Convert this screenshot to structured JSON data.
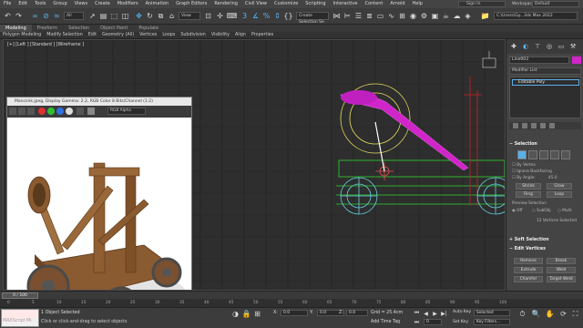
{
  "menu": [
    "File",
    "Edit",
    "Tools",
    "Group",
    "Views",
    "Create",
    "Modifiers",
    "Animation",
    "Graph Editors",
    "Rendering",
    "Civil View",
    "Customize",
    "Scripting",
    "Interactive",
    "Content",
    "Arnold",
    "Help"
  ],
  "signin": "Sign In",
  "workspaces_label": "Workspaces:",
  "workspace_value": "Default",
  "toolbar": {
    "view_dropdown": "View",
    "create_selection_set": "Create Selection Se",
    "path_value": "C:\\Users\\Gy...3ds Max 2022"
  },
  "ribbon_tabs": [
    "Modeling",
    "Freeform",
    "Selection",
    "Object Paint",
    "Populate"
  ],
  "ribbon_row2": [
    "Polygon Modeling",
    "Modify Selection",
    "Edit",
    "Geometry (All)",
    "Vertices",
    "Loops",
    "Subdivision",
    "Visibility",
    "Align",
    "Properties"
  ],
  "viewport_label": "[+] [Left ] [Standard ] [Wireframe ]",
  "frame_window": {
    "title": "Mancinik.jpeg, Display Gamma: 2.2, RGB Color 8 Bits/Channel (1:2)",
    "channel_dropdown": "RGB Alpha"
  },
  "command_panel": {
    "object_name": "Line003",
    "modifier_list": "Modifier List",
    "stack_item": "Editable Poly",
    "selection_header": "Selection",
    "by_vertex": "By Vertex",
    "ignore_backfacing": "Ignore Backfacing",
    "by_angle": "By Angle:",
    "by_angle_value": "45.0",
    "shrink": "Shrink",
    "grow": "Grow",
    "ring": "Ring",
    "loop": "Loop",
    "preview_selection": "Preview Selection",
    "preview_off": "Off",
    "preview_subobj": "SubObj",
    "preview_multi": "Multi",
    "vertices_selected": "12 Vertices Selected",
    "soft_selection": "Soft Selection",
    "edit_vertices": "Edit Vertices",
    "remove": "Remove",
    "break": "Break",
    "extrude": "Extrude",
    "weld": "Weld",
    "chamfer": "Chamfer",
    "target_weld": "Target Weld"
  },
  "timeline": {
    "slider": "0 / 100",
    "ticks": [
      "0",
      "5",
      "10",
      "15",
      "20",
      "25",
      "30",
      "35",
      "40",
      "45",
      "50",
      "55",
      "60",
      "65",
      "70",
      "75",
      "80",
      "85",
      "90",
      "95",
      "100"
    ]
  },
  "status": {
    "maxscript": "MAXScript Mi",
    "selected": "1 Object Selected",
    "prompt": "Click or click-and-drag to select objects",
    "x_label": "X:",
    "x_value": "0.0",
    "y_label": "Y:",
    "y_value": "0.0",
    "z_label": "Z:",
    "z_value": "0.0",
    "grid": "Grid = 25.4cm",
    "add_time_tag": "Add Time Tag",
    "auto_key": "Auto Key",
    "auto_key_value": "Selected",
    "set_key": "Set Key",
    "key_filters": "Key Filters...",
    "frame": "0"
  },
  "colors": {
    "selected_object": "#d025c8",
    "wire_green": "#2fd22f",
    "wire_yellow": "#e8e060",
    "wire_cyan": "#6ad0e8",
    "wire_red": "#d02020",
    "accent_blue": "#5ab0e8"
  }
}
